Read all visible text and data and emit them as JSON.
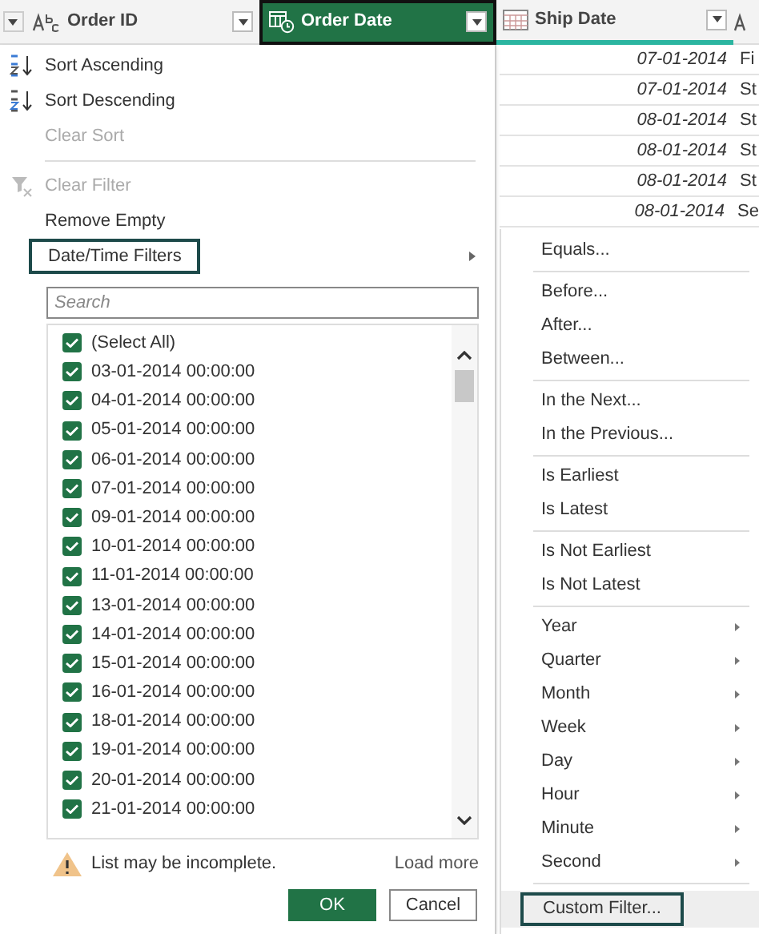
{
  "columns": [
    {
      "kind": "text",
      "label": "Order ID",
      "selected": false
    },
    {
      "kind": "datetime",
      "label": "Order Date",
      "selected": true
    },
    {
      "kind": "date",
      "label": "Ship Date",
      "selected": false
    }
  ],
  "rows": [
    {
      "ship_date": "07-01-2014",
      "column_4": "Fi"
    },
    {
      "ship_date": "07-01-2014",
      "column_4": "St"
    },
    {
      "ship_date": "08-01-2014",
      "column_4": "St"
    },
    {
      "ship_date": "08-01-2014",
      "column_4": "St"
    },
    {
      "ship_date": "08-01-2014",
      "column_4": "St"
    },
    {
      "ship_date": "08-01-2014",
      "column_4": "Se"
    }
  ],
  "menu": [
    {
      "kind": "sort_asc",
      "label": "Sort Ascending",
      "disabled": false
    },
    {
      "kind": "sort_desc",
      "label": "Sort Descending",
      "disabled": false
    },
    {
      "kind": "plain",
      "label": "Clear Sort",
      "disabled": true
    },
    {
      "kind": "divider"
    },
    {
      "kind": "filter",
      "label": "Clear Filter",
      "disabled": true
    },
    {
      "kind": "plain",
      "label": "Remove Empty",
      "disabled": false
    },
    {
      "kind": "submenu",
      "label": "Date/Time Filters",
      "disabled": false,
      "selected": true
    }
  ],
  "search": {
    "placeholder": "Search"
  },
  "values": [
    {
      "label": "(Select All)",
      "checked": true
    },
    {
      "label": "03-01-2014 00:00:00",
      "checked": true
    },
    {
      "label": "04-01-2014 00:00:00",
      "checked": true
    },
    {
      "label": "05-01-2014 00:00:00",
      "checked": true
    },
    {
      "label": "06-01-2014 00:00:00",
      "checked": true
    },
    {
      "label": "07-01-2014 00:00:00",
      "checked": true
    },
    {
      "label": "09-01-2014 00:00:00",
      "checked": true
    },
    {
      "label": "10-01-2014 00:00:00",
      "checked": true
    },
    {
      "label": "11-01-2014 00:00:00",
      "checked": true
    },
    {
      "label": "13-01-2014 00:00:00",
      "checked": true
    },
    {
      "label": "14-01-2014 00:00:00",
      "checked": true
    },
    {
      "label": "15-01-2014 00:00:00",
      "checked": true
    },
    {
      "label": "16-01-2014 00:00:00",
      "checked": true
    },
    {
      "label": "18-01-2014 00:00:00",
      "checked": true
    },
    {
      "label": "19-01-2014 00:00:00",
      "checked": true
    },
    {
      "label": "20-01-2014 00:00:00",
      "checked": true
    },
    {
      "label": "21-01-2014 00:00:00",
      "checked": true
    }
  ],
  "warning": "List may be incomplete.",
  "load_more": "Load more",
  "buttons": [
    {
      "kind": "primary",
      "label": "OK"
    },
    {
      "kind": "secondary",
      "label": "Cancel"
    }
  ],
  "submenu": [
    {
      "kind": "item",
      "label": "Equals..."
    },
    {
      "kind": "divider"
    },
    {
      "kind": "item",
      "label": "Before..."
    },
    {
      "kind": "item",
      "label": "After..."
    },
    {
      "kind": "item",
      "label": "Between..."
    },
    {
      "kind": "divider"
    },
    {
      "kind": "item",
      "label": "In the Next..."
    },
    {
      "kind": "item",
      "label": "In the Previous..."
    },
    {
      "kind": "divider"
    },
    {
      "kind": "item",
      "label": "Is Earliest"
    },
    {
      "kind": "item",
      "label": "Is Latest"
    },
    {
      "kind": "divider"
    },
    {
      "kind": "item",
      "label": "Is Not Earliest"
    },
    {
      "kind": "item",
      "label": "Is Not Latest"
    },
    {
      "kind": "divider"
    },
    {
      "kind": "sub",
      "label": "Year"
    },
    {
      "kind": "sub",
      "label": "Quarter"
    },
    {
      "kind": "sub",
      "label": "Month"
    },
    {
      "kind": "sub",
      "label": "Week"
    },
    {
      "kind": "sub",
      "label": "Day"
    },
    {
      "kind": "sub",
      "label": "Hour"
    },
    {
      "kind": "sub",
      "label": "Minute"
    },
    {
      "kind": "sub",
      "label": "Second"
    },
    {
      "kind": "divider"
    },
    {
      "kind": "boxed",
      "label": "Custom Filter..."
    }
  ]
}
